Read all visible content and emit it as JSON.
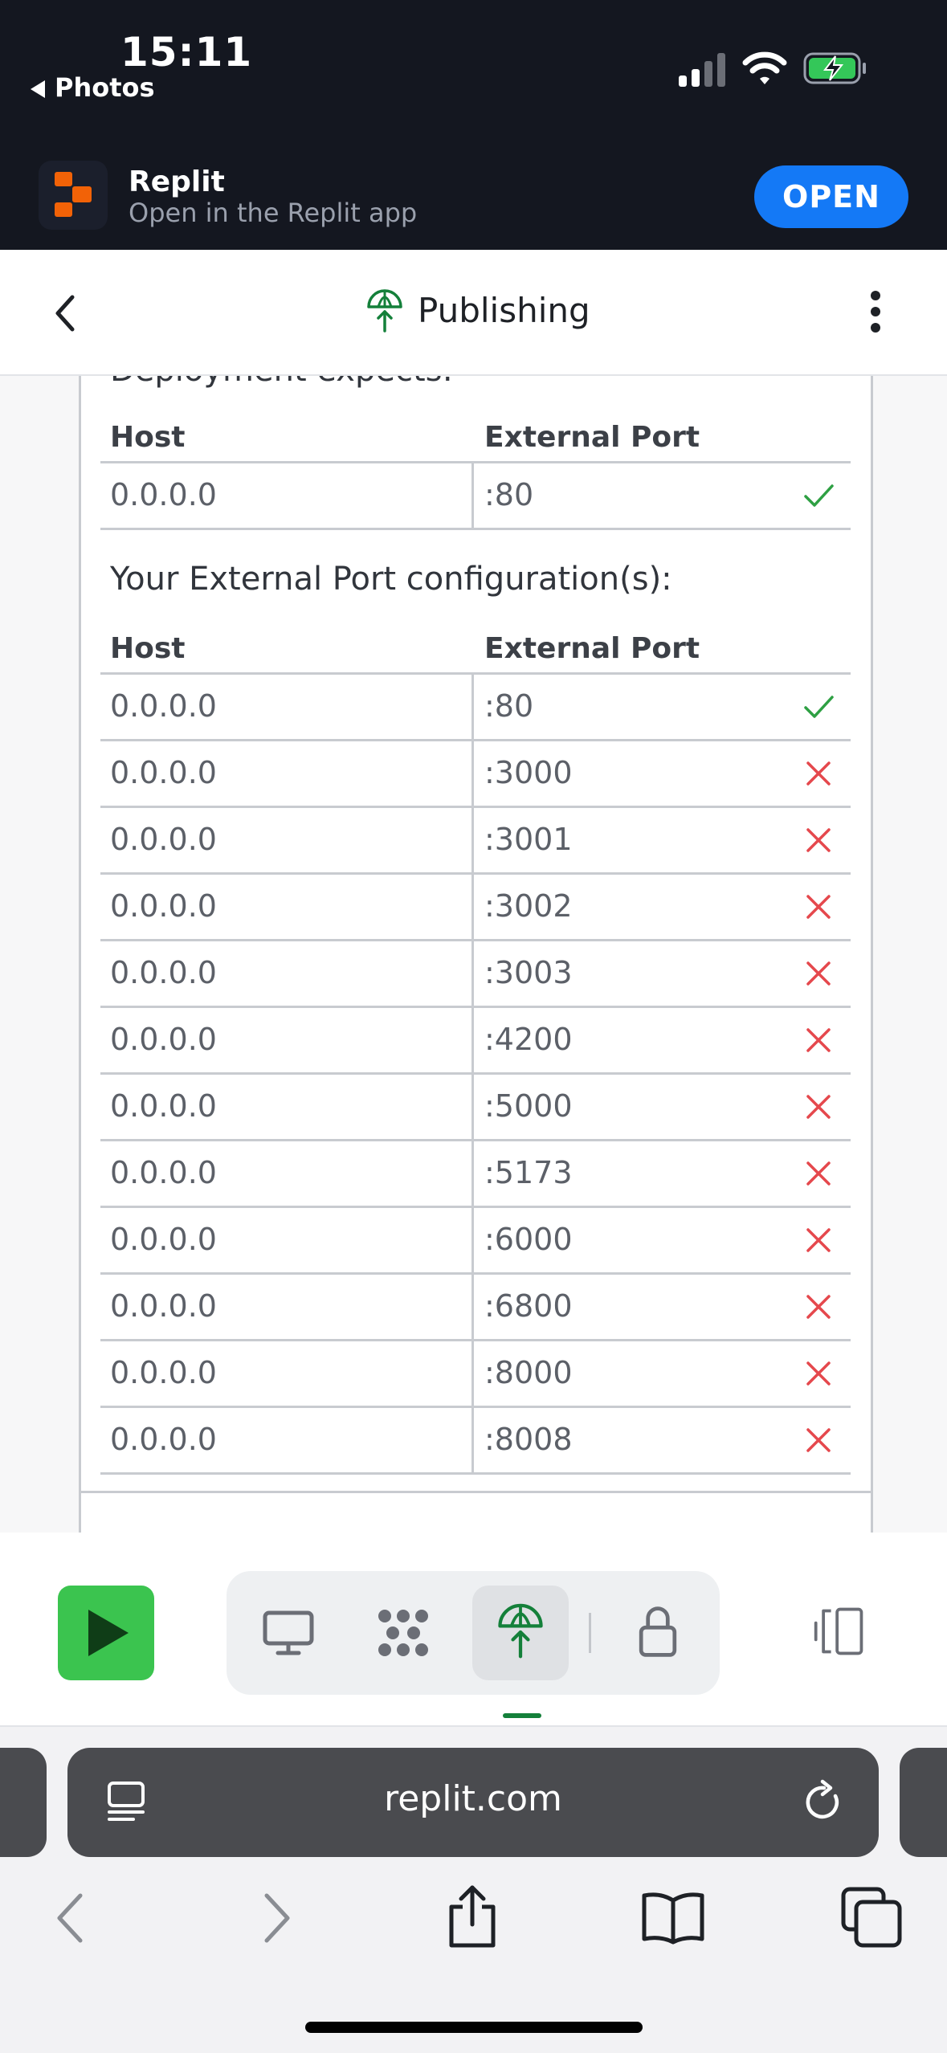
{
  "status_bar": {
    "time": "15:11",
    "back_app": "Photos"
  },
  "app_banner": {
    "name": "Replit",
    "subtitle": "Open in the Replit app",
    "open_label": "OPEN"
  },
  "header": {
    "title": "Publishing"
  },
  "content": {
    "cut_off_text": "Deployment expects:",
    "expected_table": {
      "headers": {
        "host": "Host",
        "port": "External Port"
      },
      "rows": [
        {
          "host": "0.0.0.0",
          "port": ":80",
          "status": "ok"
        }
      ]
    },
    "config_label": "Your External Port configuration(s):",
    "config_table": {
      "headers": {
        "host": "Host",
        "port": "External Port"
      },
      "rows": [
        {
          "host": "0.0.0.0",
          "port": ":80",
          "status": "ok"
        },
        {
          "host": "0.0.0.0",
          "port": ":3000",
          "status": "error"
        },
        {
          "host": "0.0.0.0",
          "port": ":3001",
          "status": "error"
        },
        {
          "host": "0.0.0.0",
          "port": ":3002",
          "status": "error"
        },
        {
          "host": "0.0.0.0",
          "port": ":3003",
          "status": "error"
        },
        {
          "host": "0.0.0.0",
          "port": ":4200",
          "status": "error"
        },
        {
          "host": "0.0.0.0",
          "port": ":5000",
          "status": "error"
        },
        {
          "host": "0.0.0.0",
          "port": ":5173",
          "status": "error"
        },
        {
          "host": "0.0.0.0",
          "port": ":6000",
          "status": "error"
        },
        {
          "host": "0.0.0.0",
          "port": ":6800",
          "status": "error"
        },
        {
          "host": "0.0.0.0",
          "port": ":8000",
          "status": "error"
        },
        {
          "host": "0.0.0.0",
          "port": ":8008",
          "status": "error"
        }
      ]
    }
  },
  "toolbar": {
    "items": [
      "run-icon",
      "preview-icon",
      "workflows-icon",
      "publishing-icon",
      "secrets-icon",
      "panels-icon"
    ],
    "active": "publishing-icon"
  },
  "browser": {
    "url": "replit.com"
  },
  "colors": {
    "ok": "#2ea043",
    "error": "#e5484d",
    "run": "#3bc44f",
    "brand_orange": "#f26207",
    "accent_blue": "#1479f6",
    "publish_green": "#14803a"
  }
}
